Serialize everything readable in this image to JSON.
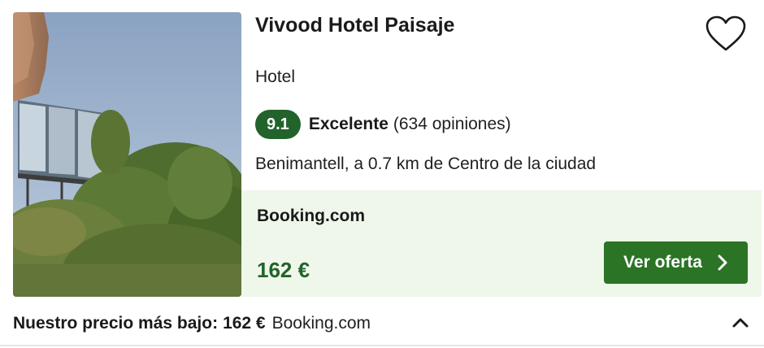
{
  "hotel": {
    "name": "Vivood Hotel Paisaje",
    "type": "Hotel",
    "rating_score": "9.1",
    "rating_label": "Excelente",
    "reviews": "(634 opiniones)",
    "location": "Benimantell, a 0.7 km de Centro de la ciudad",
    "image_icon": "hotel-photo"
  },
  "offer": {
    "provider": "Booking.com",
    "price": "162 €",
    "cta_label": "Ver oferta",
    "cta_icon": "chevron-right-icon"
  },
  "summary": {
    "lowest_label": "Nuestro precio más bajo:",
    "lowest_price": "162 €",
    "lowest_provider": "Booking.com",
    "toggle_icon": "chevron-up-icon"
  },
  "colors": {
    "score_badge": "#21632b",
    "price_text": "#21632b",
    "cta_button": "#2b7325",
    "offer_background": "#eff7ea"
  }
}
